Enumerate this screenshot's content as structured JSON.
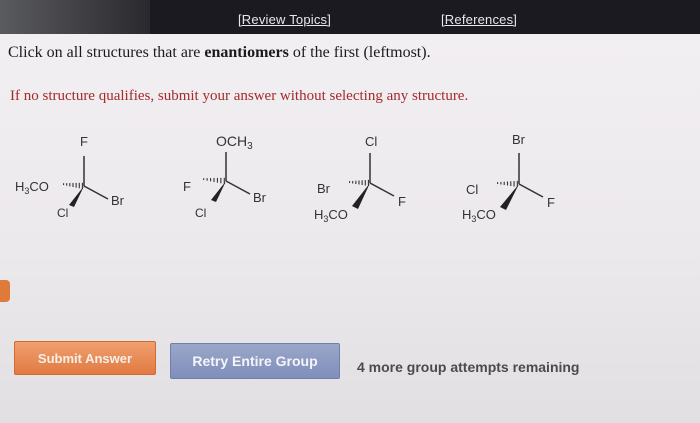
{
  "header": {
    "review_topics": "[Review Topics]",
    "references": "[References]"
  },
  "question": {
    "prefix": "Click on all structures that are ",
    "emphasis": "enantiomers",
    "suffix": " of the first (leftmost)."
  },
  "hint": "If no structure qualifies, submit your answer without selecting any structure.",
  "structures": [
    {
      "top": "F",
      "dash": "H3CO",
      "wedge": "Cl",
      "right": "Br"
    },
    {
      "top": "OCH3",
      "dash": "F",
      "wedge": "Cl",
      "right": "Br"
    },
    {
      "top": "Cl",
      "dash": "Br",
      "wedge": "H3CO",
      "right": "F"
    },
    {
      "top": "Br",
      "dash": "Cl",
      "wedge": "H3CO",
      "right": "F"
    }
  ],
  "buttons": {
    "submit": "Submit Answer",
    "retry": "Retry Entire Group"
  },
  "attempts_text": "4 more group attempts remaining",
  "colors": {
    "header_bg": "#1c1a21",
    "hint_text": "#a52a2a",
    "submit_bg": "#e07a42",
    "retry_bg": "#8494c0"
  }
}
